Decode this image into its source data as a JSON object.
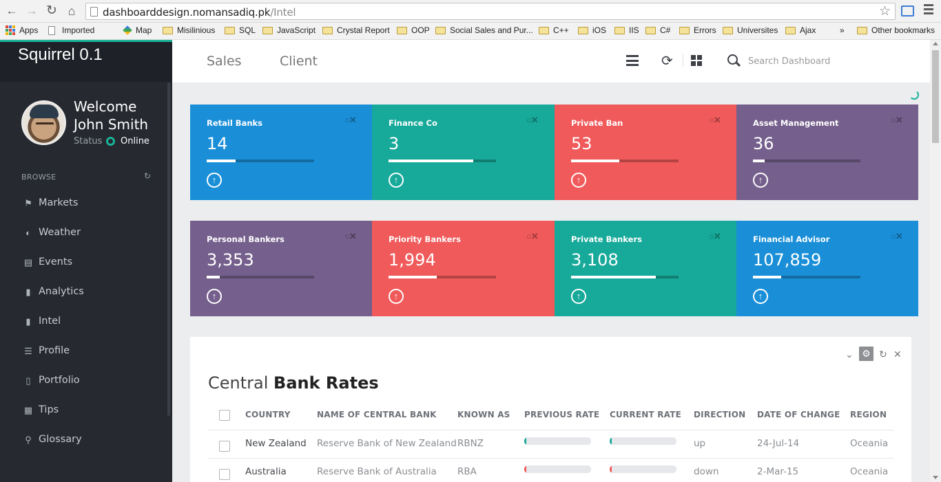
{
  "browser": {
    "url_domain": "dashboarddesign.nomansadiq.pk",
    "url_path": "/Intel",
    "bookmarks": [
      "Apps",
      "Imported",
      "Map",
      "Misilinious",
      "SQL",
      "JavaScript",
      "Crystal Report",
      "OOP",
      "Social Sales and Pur...",
      "C++",
      "iOS",
      "IIS",
      "C#",
      "Errors",
      "Universites",
      "Ajax"
    ],
    "overflow": "»",
    "other_bookmarks": "Other bookmarks"
  },
  "sidebar": {
    "brand": "Squirrel 0.1",
    "welcome": "Welcome",
    "user_name": "John Smith",
    "status_label": "Status",
    "status_value": "Online",
    "section": "BROWSE",
    "items": [
      {
        "label": "Markets",
        "icon": "flag-icon"
      },
      {
        "label": "Weather",
        "icon": "contrast-icon"
      },
      {
        "label": "Events",
        "icon": "document-icon"
      },
      {
        "label": "Analytics",
        "icon": "bookmark-icon"
      },
      {
        "label": "Intel",
        "icon": "bookmark-icon"
      },
      {
        "label": "Profile",
        "icon": "list-icon"
      },
      {
        "label": "Portfolio",
        "icon": "book-icon"
      },
      {
        "label": "Tips",
        "icon": "grid-icon"
      },
      {
        "label": "Glossary",
        "icon": "pin-icon"
      }
    ]
  },
  "header": {
    "tabs": [
      "Sales",
      "Client"
    ],
    "search_placeholder": "Search Dashboard"
  },
  "tiles": [
    {
      "title": "Retail Banks",
      "value": "14",
      "progress": 0.27,
      "color": "#1a8fd8"
    },
    {
      "title": "Finance Co",
      "value": "3",
      "progress": 0.79,
      "color": "#17a999"
    },
    {
      "title": "Private Ban",
      "value": "53",
      "progress": 0.45,
      "color": "#f05a5b"
    },
    {
      "title": "Asset Management",
      "value": "36",
      "progress": 0.11,
      "color": "#755f8c"
    },
    {
      "title": "Personal Bankers",
      "value": "3,353",
      "progress": 0.12,
      "color": "#755f8c"
    },
    {
      "title": "Priority Bankers",
      "value": "1,994",
      "progress": 0.45,
      "color": "#f05a5b"
    },
    {
      "title": "Private Bankers",
      "value": "3,108",
      "progress": 0.79,
      "color": "#17a999"
    },
    {
      "title": "Financial Advisor",
      "value": "107,859",
      "progress": 0.26,
      "color": "#1a8fd8"
    }
  ],
  "panel": {
    "title_light": "Central",
    "title_bold": "Bank Rates",
    "columns": [
      "COUNTRY",
      "NAME OF CENTRAL BANK",
      "KNOWN AS",
      "PREVIOUS RATE",
      "CURRENT RATE",
      "DIRECTION",
      "DATE OF CHANGE",
      "REGION"
    ],
    "rows": [
      {
        "country": "New Zealand",
        "bank": "Reserve Bank of New Zealand",
        "known_as": "RBNZ",
        "prev_rate": 0.03,
        "curr_rate": 0.03,
        "rate_color": "#17a999",
        "direction": "up",
        "date": "24-Jul-14",
        "region": "Oceania"
      },
      {
        "country": "Australia",
        "bank": "Reserve Bank of Australia",
        "known_as": "RBA",
        "prev_rate": 0.03,
        "curr_rate": 0.03,
        "rate_color": "#f05a5b",
        "direction": "down",
        "date": "2-Mar-15",
        "region": "Oceania"
      }
    ]
  }
}
